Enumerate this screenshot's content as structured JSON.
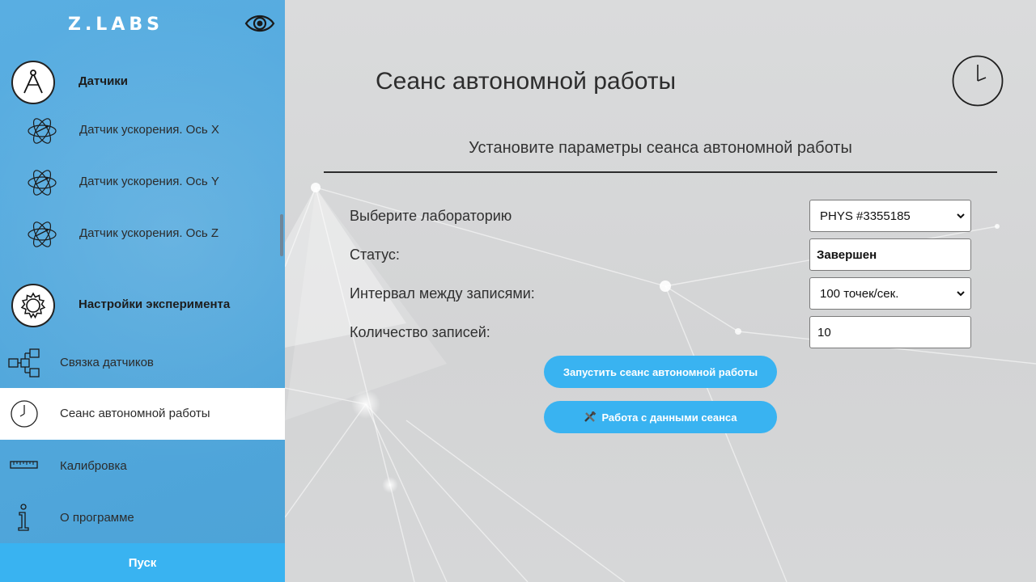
{
  "app": {
    "logo": "Z.LABS"
  },
  "sidebar": {
    "sensors_title": "Датчики",
    "sensors": [
      {
        "label": "Датчик ускорения. Ось X"
      },
      {
        "label": "Датчик ускорения. Ось Y"
      },
      {
        "label": "Датчик ускорения. Ось Z"
      }
    ],
    "settings_title": "Настройки эксперимента",
    "nav": [
      {
        "label": "Связка датчиков",
        "icon": "sensor-link-icon"
      },
      {
        "label": "Сеанс автономной работы",
        "icon": "clock-icon",
        "active": true
      },
      {
        "label": "Калибровка",
        "icon": "ruler-icon"
      },
      {
        "label": "О программе",
        "icon": "info-icon"
      }
    ],
    "start_label": "Пуск"
  },
  "main": {
    "title": "Сеанс автономной работы",
    "subtitle": "Установите параметры сеанса автономной работы",
    "fields": {
      "lab_label": "Выберите лабораторию",
      "lab_value": "PHYS #3355185",
      "status_label": "Статус:",
      "status_value": "Завершен",
      "interval_label": "Интервал между записями:",
      "interval_value": "100 точек/сек.",
      "count_label": "Количество записей:",
      "count_value": "10"
    },
    "start_session_button": "Запустить сеанс автономной работы",
    "session_data_button": "Работа с данными сеанса"
  },
  "colors": {
    "sidebar_bg": "#4fa9e0",
    "accent_button": "#39b3f1",
    "active_item_bg": "#ffffff"
  }
}
